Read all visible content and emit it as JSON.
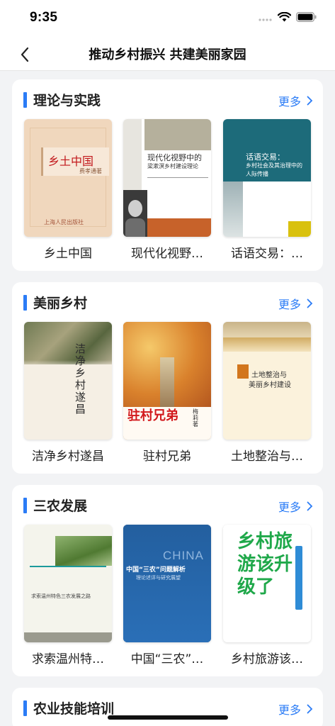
{
  "status": {
    "time": "9:35"
  },
  "nav": {
    "title": "推动乡村振兴 共建美丽家园"
  },
  "more_label": "更多",
  "sections": [
    {
      "title": "理论与实践",
      "books": [
        {
          "title": "乡土中国",
          "cover": {
            "main": "乡土中国",
            "author": "费孝通著",
            "publisher": "上海人民出版社"
          }
        },
        {
          "title": "现代化视野…",
          "cover": {
            "line1": "现代化视野中的",
            "line2": "梁漱溟乡村建设理论"
          }
        },
        {
          "title": "话语交易：…",
          "cover": {
            "line1": "话语交易：",
            "line2": "乡村社会及其治理中的",
            "line3": "人际传播"
          }
        }
      ]
    },
    {
      "title": "美丽乡村",
      "books": [
        {
          "title": "洁净乡村遂昌",
          "cover": {
            "main": "洁净乡村遂昌"
          }
        },
        {
          "title": "驻村兄弟",
          "cover": {
            "main": "驻村兄弟",
            "author": "梅莉著"
          }
        },
        {
          "title": "土地整治与…",
          "cover": {
            "line1": "土地整治与",
            "line2": "美丽乡村建设"
          }
        }
      ]
    },
    {
      "title": "三农发展",
      "books": [
        {
          "title": "求索温州特…",
          "cover": {
            "line1": "求索温州特色三农发展之路"
          }
        },
        {
          "title": "中国“三农”…",
          "cover": {
            "en": "CHINA",
            "line1": "中国“三农”问题解析",
            "line2": "理论述评与研究展望"
          }
        },
        {
          "title": "乡村旅游该…",
          "cover": {
            "main": "乡村旅游该升级了"
          }
        }
      ]
    },
    {
      "title": "农业技能培训",
      "books": []
    }
  ],
  "colors": {
    "accent": "#2b7cf6",
    "background": "#f2f3f5"
  }
}
